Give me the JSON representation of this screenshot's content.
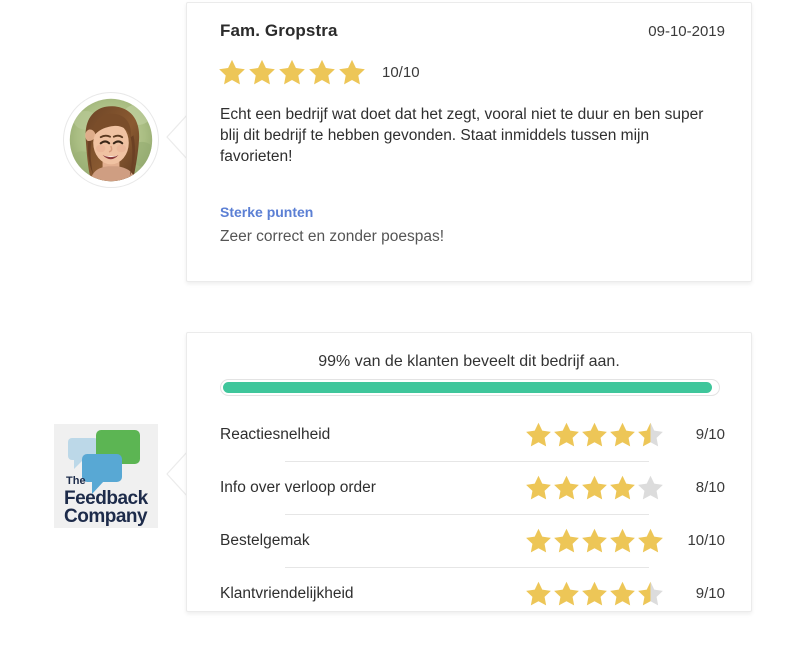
{
  "review": {
    "author": "Fam. Gropstra",
    "date": "09-10-2019",
    "score": "10/10",
    "stars": 10,
    "body": "Echt een bedrijf wat doet dat het zegt, vooral niet te duur en ben super blij dit bedrijf te hebben gevonden. Staat inmiddels tussen mijn favorieten!",
    "pros_label": "Sterke punten",
    "pros_text": "Zeer correct en zonder poespas!",
    "avatar_alt": "reviewer-avatar-photo"
  },
  "summary": {
    "recommend_text": "99% van de klanten beveelt dit bedrijf aan.",
    "recommend_percent": 99,
    "logo_alt": "the-feedback-company-logo",
    "logo_text_line1": "The",
    "logo_text_line2": "Feedback",
    "logo_text_line3": "Company",
    "ratings": [
      {
        "label": "Reactiesnelheid",
        "score": "9/10",
        "stars": 9
      },
      {
        "label": "Info over verloop order",
        "score": "8/10",
        "stars": 8
      },
      {
        "label": "Bestelgemak",
        "score": "10/10",
        "stars": 10
      },
      {
        "label": "Klantvriendelijkheid",
        "score": "9/10",
        "stars": 9
      }
    ]
  },
  "colors": {
    "star_filled": "#edc657",
    "star_empty": "#dcdcdc",
    "progress_fill": "#3fc69b",
    "pros_link": "#5b7fd4",
    "card_border": "#ebebeb",
    "logo_bg": "#f0f0f0",
    "logo_green": "#5cb553",
    "logo_blue": "#58a8d4",
    "logo_lightblue": "#bcd8e8",
    "logo_text": "#1d2b4a"
  }
}
